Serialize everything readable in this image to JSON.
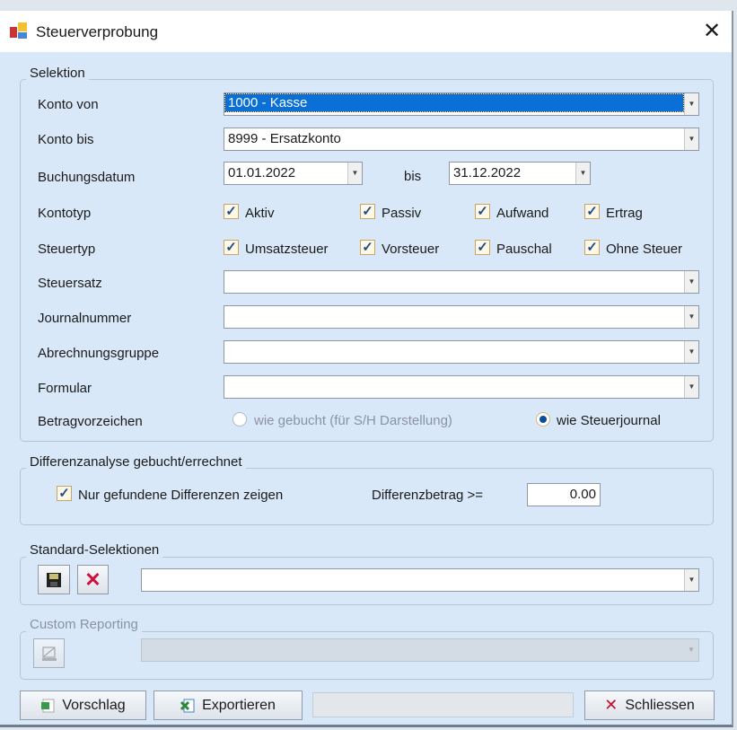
{
  "window": {
    "title": "Steuerverprobung",
    "close": "✕"
  },
  "selektion": {
    "legend": "Selektion",
    "konto_von": {
      "label": "Konto von",
      "value": "1000 - Kasse"
    },
    "konto_bis": {
      "label": "Konto bis",
      "value": "8999 - Ersatzkonto"
    },
    "buchungsdatum": {
      "label": "Buchungsdatum",
      "from": "01.01.2022",
      "bis": "bis",
      "to": "31.12.2022"
    },
    "kontotyp": {
      "label": "Kontotyp",
      "options": [
        "Aktiv",
        "Passiv",
        "Aufwand",
        "Ertrag"
      ],
      "checked": [
        true,
        true,
        true,
        true
      ]
    },
    "steuertyp": {
      "label": "Steuertyp",
      "options": [
        "Umsatzsteuer",
        "Vorsteuer",
        "Pauschal",
        "Ohne Steuer"
      ],
      "checked": [
        true,
        true,
        true,
        true
      ]
    },
    "steuersatz": {
      "label": "Steuersatz",
      "value": ""
    },
    "journalnummer": {
      "label": "Journalnummer",
      "value": ""
    },
    "abrechnungsgruppe": {
      "label": "Abrechnungsgruppe",
      "value": ""
    },
    "formular": {
      "label": "Formular",
      "value": ""
    },
    "betragvorzeichen": {
      "label": "Betragvorzeichen",
      "option1": "wie gebucht (für S/H Darstellung)",
      "option2": "wie Steuerjournal",
      "selected": "wie Steuerjournal"
    }
  },
  "differenz": {
    "legend": "Differenzanalyse gebucht/errechnet",
    "checkbox": "Nur gefundene Differenzen zeigen",
    "checked": true,
    "betrag_label": "Differenzbetrag >=",
    "betrag": "0.00"
  },
  "standard": {
    "legend": "Standard-Selektionen",
    "value": ""
  },
  "custom": {
    "legend": "Custom Reporting"
  },
  "buttons": {
    "vorschlag": "Vorschlag",
    "exportieren": "Exportieren",
    "schliessen": "Schliessen"
  }
}
